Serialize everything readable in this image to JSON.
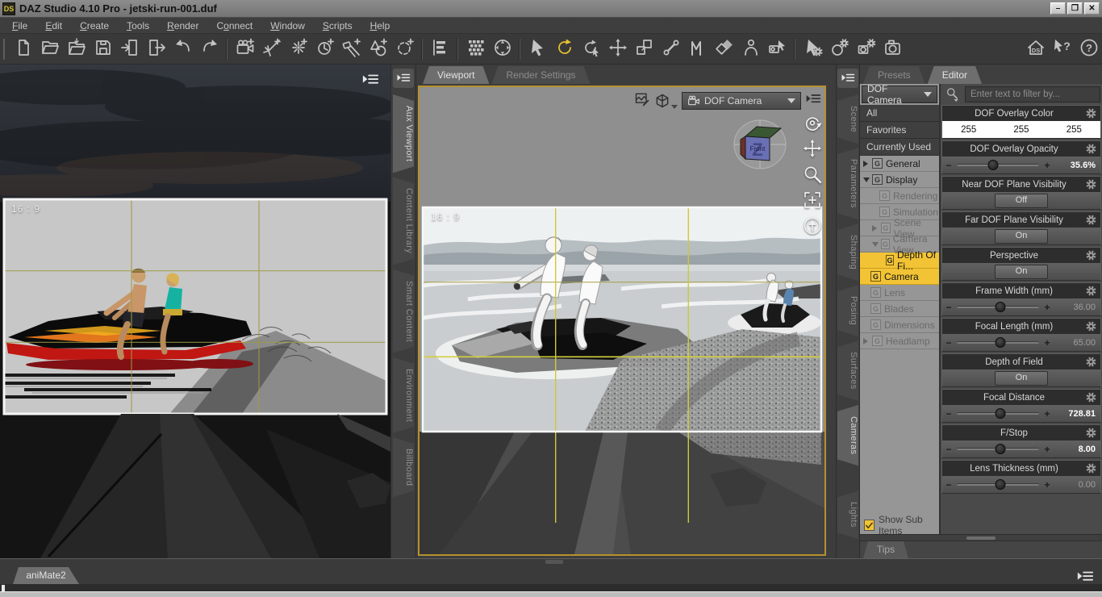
{
  "window": {
    "title": "DAZ Studio 4.10 Pro - jetski-run-001.duf",
    "logo": "DS",
    "minimize": "–",
    "maximize": "❐",
    "close": "✕"
  },
  "menu_bar": {
    "items": [
      {
        "label": "File",
        "u": 0
      },
      {
        "label": "Edit",
        "u": 0
      },
      {
        "label": "Create",
        "u": 0
      },
      {
        "label": "Tools",
        "u": 0
      },
      {
        "label": "Render",
        "u": 0
      },
      {
        "label": "Connect",
        "u": 1
      },
      {
        "label": "Window",
        "u": 0
      },
      {
        "label": "Scripts",
        "u": 0
      },
      {
        "label": "Help",
        "u": 0
      }
    ]
  },
  "toolbar": {
    "active_tool": "rotate-tool",
    "groups": [
      [
        "new-file",
        "open-file",
        "merge-file",
        "save-file",
        "import",
        "export",
        "undo",
        "redo"
      ],
      [
        "add-camera",
        "add-distant-light",
        "add-point-light",
        "add-bulb",
        "add-spotlight",
        "add-primitive",
        "add-group"
      ],
      [
        "outline-options"
      ],
      [
        "content-grid",
        "scene-navigator"
      ],
      [
        "node-cursor",
        "rotate-tool",
        "orbit-tool",
        "translate-tool",
        "scale-tool",
        "joint-editor",
        "geometry-editor",
        "polygon-group-editor",
        "figure-setup",
        "camera-cursor"
      ],
      [
        "pointer-gear",
        "surface-gear",
        "render-settings",
        "render-camera"
      ],
      [
        "home-ds",
        "whats-this",
        "help"
      ]
    ]
  },
  "left_pane": {
    "aspect_label": "16 : 9"
  },
  "left_tabs": {
    "items": [
      "Aux Viewport",
      "Content Library",
      "Smart Content",
      "Environment",
      "Billboard"
    ],
    "active": "Aux Viewport"
  },
  "center": {
    "tabs": [
      {
        "label": "Viewport",
        "active": true
      },
      {
        "label": "Render Settings",
        "active": false
      }
    ],
    "camera_dropdown": "DOF Camera",
    "aspect_label": "16 : 9",
    "view_cube": {
      "axis": "Z",
      "face": "Front"
    },
    "view_tools": [
      "orbit",
      "pan",
      "zoom",
      "frame",
      "aim"
    ]
  },
  "right_tabs": {
    "items": [
      "Scene",
      "Parameters",
      "Shaping",
      "Posing",
      "Surfaces",
      "Cameras",
      "Lights"
    ],
    "active": "Cameras"
  },
  "right_panel": {
    "tabs": [
      {
        "label": "Presets",
        "active": false
      },
      {
        "label": "Editor",
        "active": true
      }
    ],
    "camera_dropdown": "DOF Camera",
    "filter_placeholder": "Enter text to filter by...",
    "quick_groups": [
      "All",
      "Favorites",
      "Currently Used"
    ],
    "group_icon_letter": "G",
    "tree": [
      {
        "label": "General",
        "level": 0,
        "arrow": "collapsed",
        "state": "normal"
      },
      {
        "label": "Display",
        "level": 0,
        "arrow": "expanded",
        "state": "normal"
      },
      {
        "label": "Rendering",
        "level": 1,
        "arrow": "none",
        "state": "dim"
      },
      {
        "label": "Simulation",
        "level": 1,
        "arrow": "none",
        "state": "dim"
      },
      {
        "label": "Scene View",
        "level": 1,
        "arrow": "collapsed",
        "state": "dim"
      },
      {
        "label": "Camera View",
        "level": 1,
        "arrow": "expanded",
        "state": "dim"
      },
      {
        "label": "Depth Of Fi...",
        "level": 2,
        "arrow": "none",
        "state": "selected"
      },
      {
        "label": "Camera",
        "level": 0,
        "arrow": "none",
        "state": "selected"
      },
      {
        "label": "Lens",
        "level": 0,
        "arrow": "none",
        "state": "dim"
      },
      {
        "label": "Blades",
        "level": 0,
        "arrow": "none",
        "state": "dim"
      },
      {
        "label": "Dimensions",
        "level": 0,
        "arrow": "none",
        "state": "dim"
      },
      {
        "label": "Headlamp",
        "level": 0,
        "arrow": "collapsed",
        "state": "dim"
      }
    ],
    "slider_minus": "−",
    "slider_plus": "+",
    "params": [
      {
        "label": "DOF Overlay Color",
        "type": "color",
        "values": [
          "255",
          "255",
          "255"
        ]
      },
      {
        "label": "DOF Overlay Opacity",
        "type": "slider",
        "value": "35.6%",
        "fill": 0.44,
        "emph": true
      },
      {
        "label": "Near DOF Plane Visibility",
        "type": "toggle",
        "value": "Off"
      },
      {
        "label": "Far DOF Plane Visibility",
        "type": "toggle",
        "value": "On"
      },
      {
        "label": "Perspective",
        "type": "toggle",
        "value": "On"
      },
      {
        "label": "Frame Width (mm)",
        "type": "slider",
        "value": "36.00",
        "fill": 0.53,
        "emph": false
      },
      {
        "label": "Focal Length (mm)",
        "type": "slider",
        "value": "65.00",
        "fill": 0.53,
        "emph": false
      },
      {
        "label": "Depth of Field",
        "type": "toggle",
        "value": "On"
      },
      {
        "label": "Focal Distance",
        "type": "slider",
        "value": "728.81",
        "fill": 0.53,
        "emph": true
      },
      {
        "label": "F/Stop",
        "type": "slider",
        "value": "8.00",
        "fill": 0.53,
        "emph": true
      },
      {
        "label": "Lens Thickness (mm)",
        "type": "slider",
        "value": "0.00",
        "fill": 0.53,
        "emph": false
      }
    ],
    "show_sub_items": "Show Sub Items",
    "tips_label": "Tips"
  },
  "bottom": {
    "tab_label": "aniMate2"
  },
  "colors": {
    "accent": "#e8c331",
    "selection": "#f2c335",
    "viewport_border": "#b5912f",
    "grid_line": "#a09a42",
    "bright_grid": "#d6cf3e"
  }
}
